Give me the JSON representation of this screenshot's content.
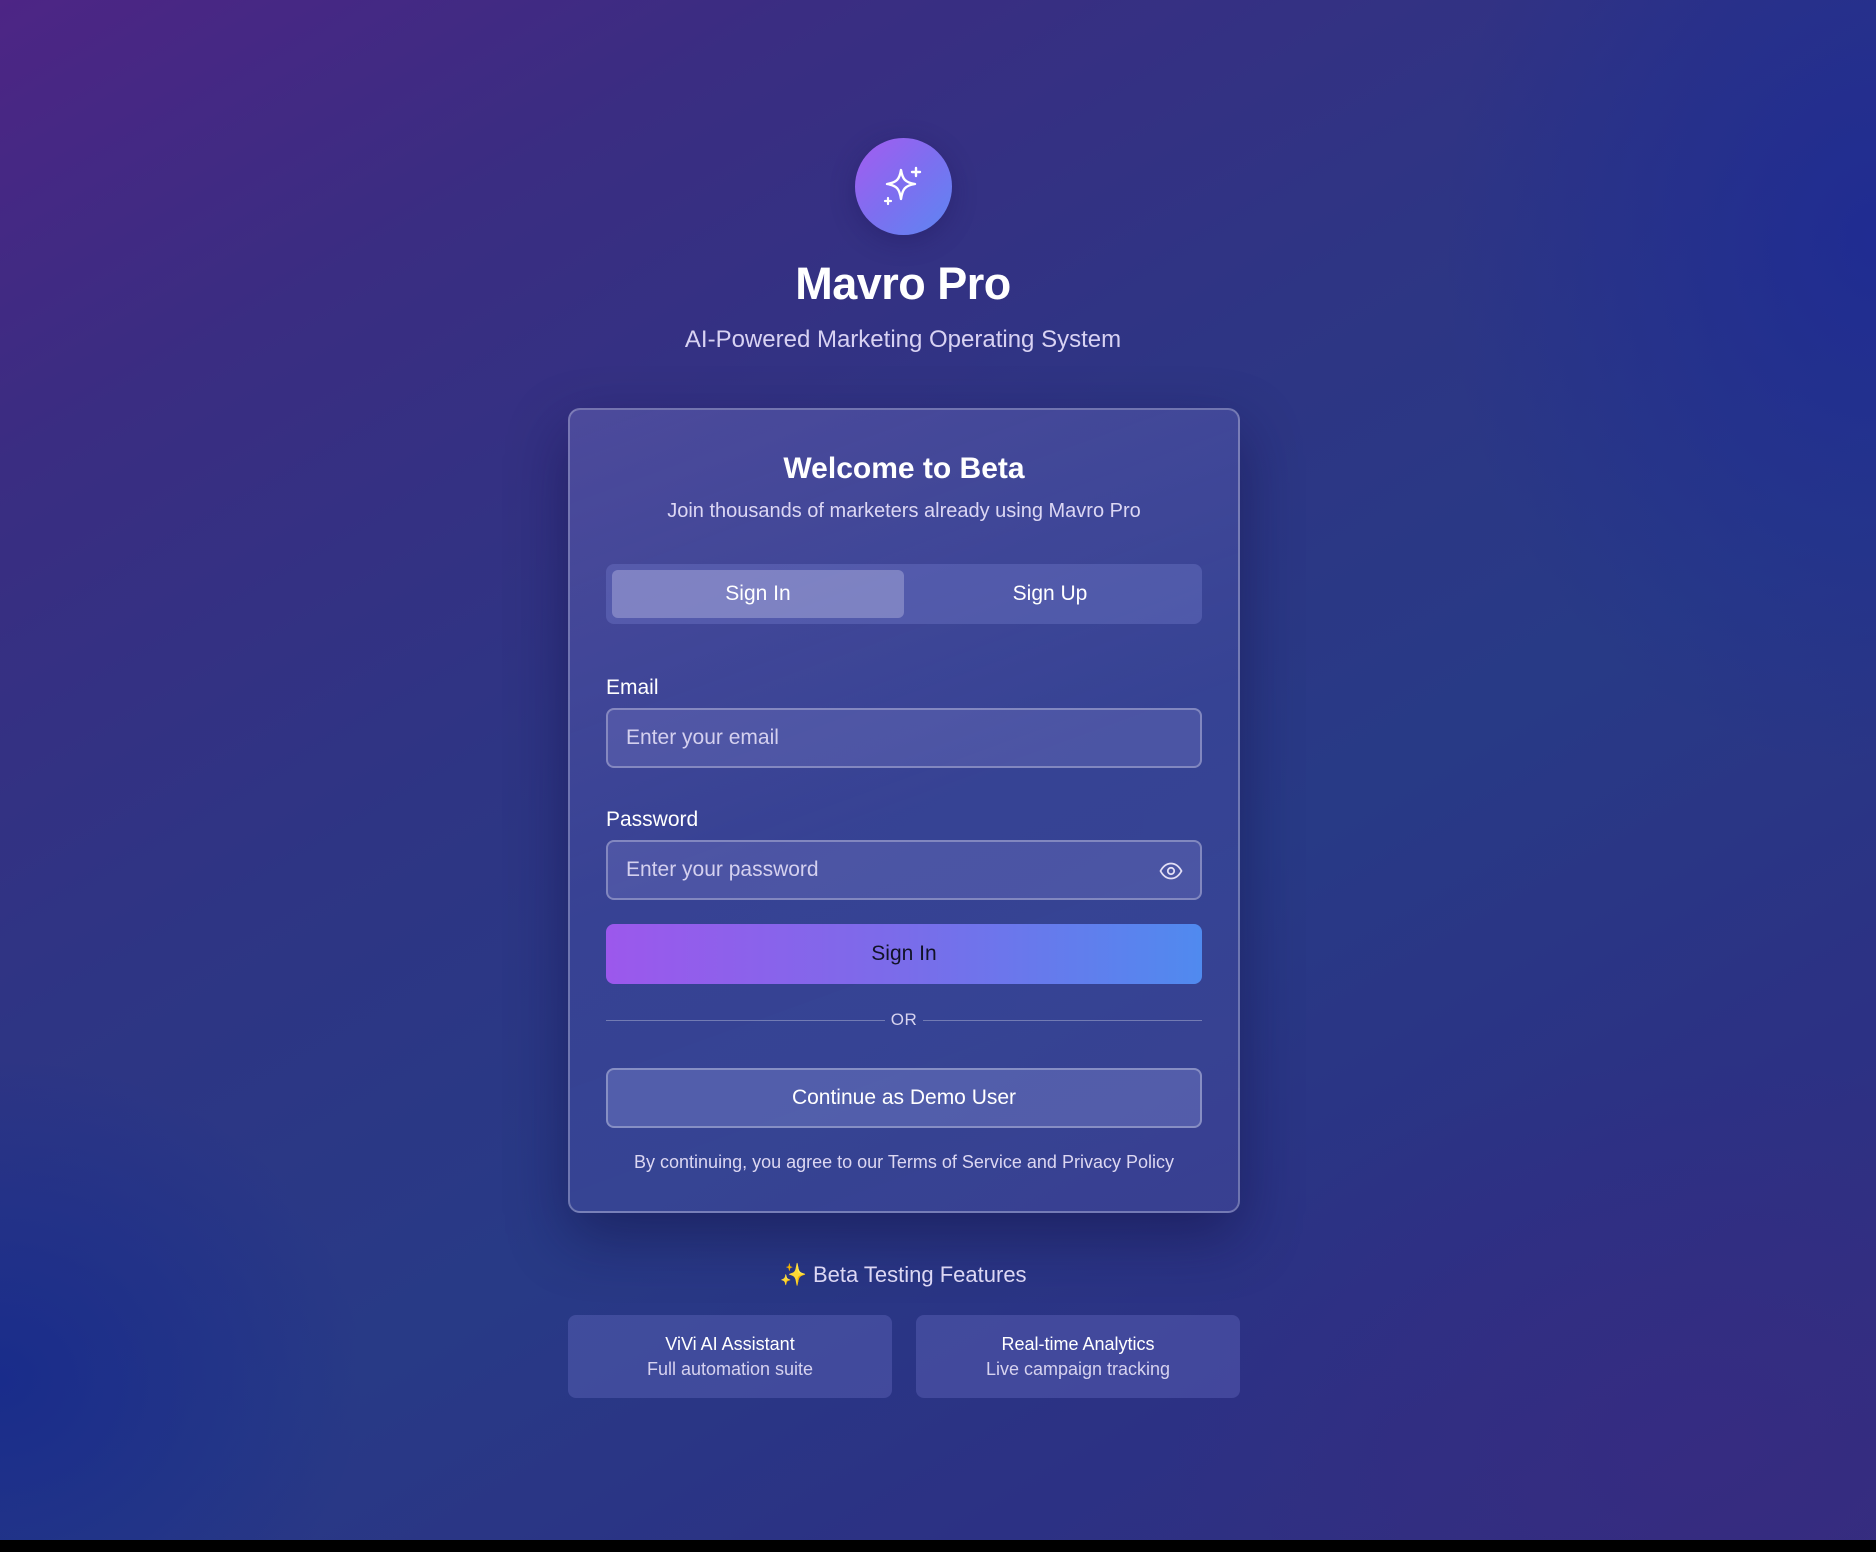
{
  "brand": {
    "name": "Mavro Pro",
    "tagline": "AI-Powered Marketing Operating System",
    "logo_icon": "sparkle-icon"
  },
  "card": {
    "title": "Welcome to Beta",
    "subtitle": "Join thousands of marketers already using Mavro Pro",
    "tabs": [
      {
        "label": "Sign In",
        "active": true
      },
      {
        "label": "Sign Up",
        "active": false
      }
    ],
    "email": {
      "label": "Email",
      "value": "",
      "placeholder": "Enter your email"
    },
    "password": {
      "label": "Password",
      "value": "",
      "placeholder": "Enter your password",
      "toggle_icon": "eye-icon"
    },
    "submit_label": "Sign In",
    "divider_label": "OR",
    "demo_label": "Continue as Demo User",
    "legal": {
      "prefix": "By continuing, you agree to our ",
      "terms": "Terms of Service",
      "and": " and ",
      "privacy": "Privacy Policy"
    }
  },
  "features": {
    "title": "✨ Beta Testing Features",
    "items": [
      {
        "title": "ViVi AI Assistant",
        "desc": "Full automation suite"
      },
      {
        "title": "Real-time Analytics",
        "desc": "Live campaign tracking"
      }
    ]
  },
  "colors": {
    "accent_start": "#9c58ec",
    "accent_end": "#508aef",
    "background": "#2e3584"
  }
}
